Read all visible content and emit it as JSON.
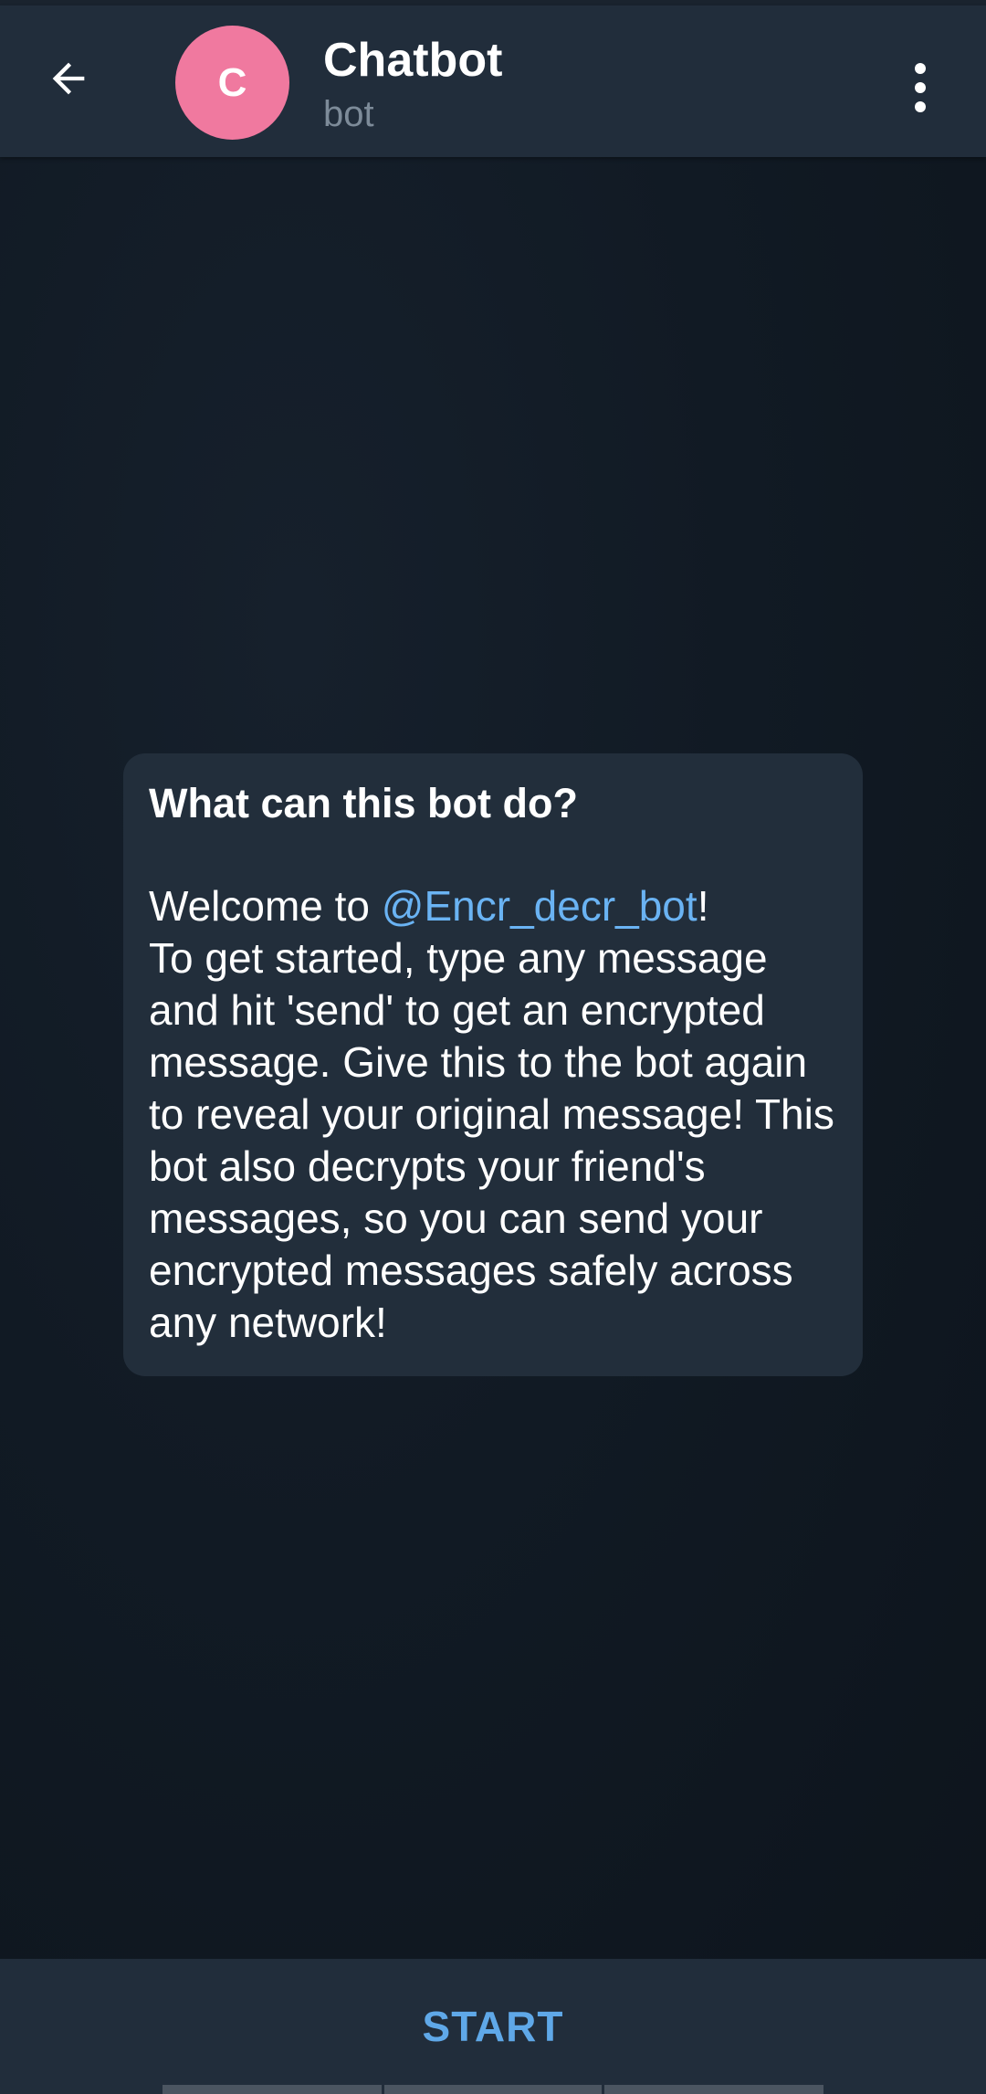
{
  "header": {
    "avatar_letter": "C",
    "avatar_color": "#f0799f",
    "title": "Chatbot",
    "subtitle": "bot",
    "back_icon": "arrow-left-icon",
    "menu_icon": "more-vertical-icon"
  },
  "bot_info": {
    "title": "What can this bot do?",
    "welcome_prefix": "Welcome to ",
    "mention": "@Encr_decr_bot",
    "welcome_suffix": "!",
    "body": "To get started, type any message and hit 'send' to get an encrypted message. Give this to the bot again to reveal your original message! This bot also decrypts your friend's messages, so you can send your encrypted messages safely across any network!"
  },
  "bottom": {
    "start_label": "START"
  },
  "colors": {
    "header_bg": "#212d3b",
    "bubble_bg": "#222e3b",
    "link": "#6ab3f3",
    "accent": "#5fa8e8"
  }
}
